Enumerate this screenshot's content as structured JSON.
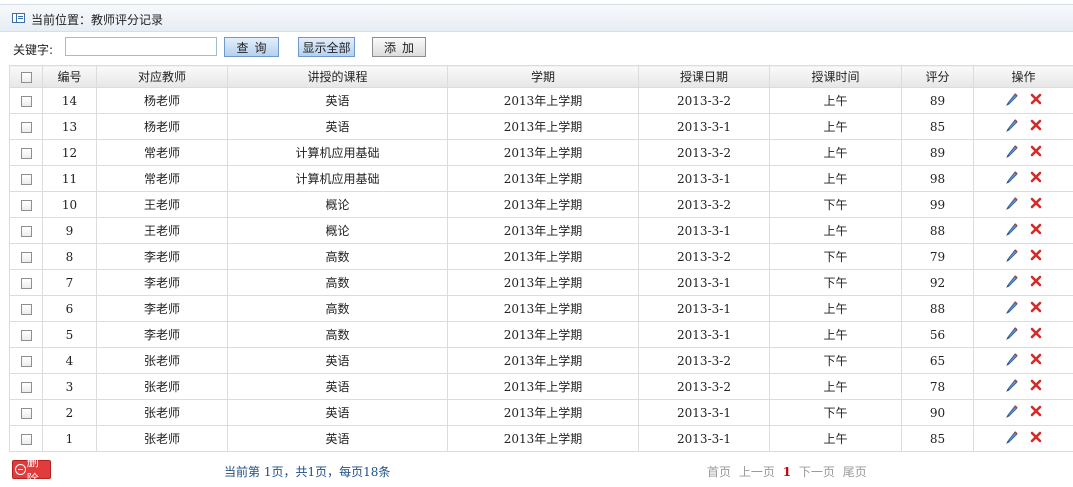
{
  "breadcrumb": {
    "label": "当前位置：教师评分记录"
  },
  "toolbar": {
    "keyword_label": "关键字:",
    "keyword_value": "",
    "query_label": "查询",
    "show_all_label": "显示全部",
    "add_label": "添加"
  },
  "table": {
    "headers": {
      "id": "编号",
      "teacher": "对应教师",
      "course": "讲授的课程",
      "term": "学期",
      "date": "授课日期",
      "time": "授课时间",
      "score": "评分",
      "ops": "操作"
    },
    "rows": [
      {
        "id": "14",
        "teacher": "杨老师",
        "course": "英语",
        "term": "2013年上学期",
        "date": "2013-3-2",
        "time": "上午",
        "score": "89"
      },
      {
        "id": "13",
        "teacher": "杨老师",
        "course": "英语",
        "term": "2013年上学期",
        "date": "2013-3-1",
        "time": "上午",
        "score": "85"
      },
      {
        "id": "12",
        "teacher": "常老师",
        "course": "计算机应用基础",
        "term": "2013年上学期",
        "date": "2013-3-2",
        "time": "上午",
        "score": "89"
      },
      {
        "id": "11",
        "teacher": "常老师",
        "course": "计算机应用基础",
        "term": "2013年上学期",
        "date": "2013-3-1",
        "time": "上午",
        "score": "98"
      },
      {
        "id": "10",
        "teacher": "王老师",
        "course": "概论",
        "term": "2013年上学期",
        "date": "2013-3-2",
        "time": "下午",
        "score": "99"
      },
      {
        "id": "9",
        "teacher": "王老师",
        "course": "概论",
        "term": "2013年上学期",
        "date": "2013-3-1",
        "time": "上午",
        "score": "88"
      },
      {
        "id": "8",
        "teacher": "李老师",
        "course": "高数",
        "term": "2013年上学期",
        "date": "2013-3-2",
        "time": "下午",
        "score": "79"
      },
      {
        "id": "7",
        "teacher": "李老师",
        "course": "高数",
        "term": "2013年上学期",
        "date": "2013-3-1",
        "time": "下午",
        "score": "92"
      },
      {
        "id": "6",
        "teacher": "李老师",
        "course": "高数",
        "term": "2013年上学期",
        "date": "2013-3-1",
        "time": "上午",
        "score": "88"
      },
      {
        "id": "5",
        "teacher": "李老师",
        "course": "高数",
        "term": "2013年上学期",
        "date": "2013-3-1",
        "time": "上午",
        "score": "56"
      },
      {
        "id": "4",
        "teacher": "张老师",
        "course": "英语",
        "term": "2013年上学期",
        "date": "2013-3-2",
        "time": "下午",
        "score": "65"
      },
      {
        "id": "3",
        "teacher": "张老师",
        "course": "英语",
        "term": "2013年上学期",
        "date": "2013-3-2",
        "time": "上午",
        "score": "78"
      },
      {
        "id": "2",
        "teacher": "张老师",
        "course": "英语",
        "term": "2013年上学期",
        "date": "2013-3-1",
        "time": "下午",
        "score": "90"
      },
      {
        "id": "1",
        "teacher": "张老师",
        "course": "英语",
        "term": "2013年上学期",
        "date": "2013-3-1",
        "time": "上午",
        "score": "85"
      }
    ]
  },
  "footer": {
    "delete_label": "删除",
    "page_info": "当前第 1页，共1页，每页18条",
    "pager": {
      "first": "首页",
      "prev": "上一页",
      "current": "1",
      "next": "下一页",
      "last": "尾页"
    }
  },
  "icons": {
    "title": "list-icon",
    "edit": "pencil-icon",
    "delete": "red-x-icon",
    "delete_button": "minus-circle-icon"
  },
  "colors": {
    "delete_button": "#e03c3c",
    "page_current": "#cc0000",
    "page_info": "#1f4f87",
    "pager_disabled": "#9a9a9a"
  }
}
